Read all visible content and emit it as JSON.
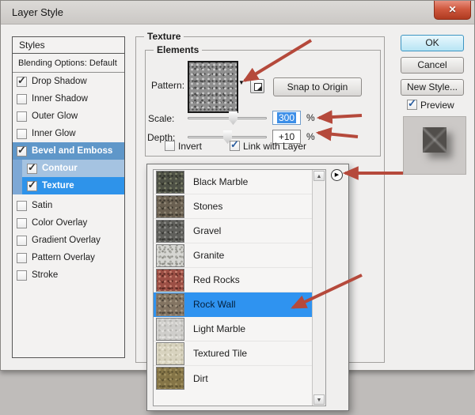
{
  "window": {
    "title": "Layer Style",
    "close_glyph": "✕"
  },
  "sidebar": {
    "header": "Styles",
    "items": [
      {
        "label": "Blending Options: Default",
        "check": ""
      },
      {
        "label": "Drop Shadow",
        "check": "✓"
      },
      {
        "label": "Inner Shadow",
        "check": ""
      },
      {
        "label": "Outer Glow",
        "check": ""
      },
      {
        "label": "Inner Glow",
        "check": ""
      },
      {
        "label": "Bevel and Emboss",
        "check": "✓",
        "selected": "medium"
      },
      {
        "label": "Contour",
        "check": "✓",
        "selected": "light",
        "sub": true
      },
      {
        "label": "Texture",
        "check": "✓",
        "selected": "bright",
        "sub": true
      },
      {
        "label": "Satin",
        "check": ""
      },
      {
        "label": "Color Overlay",
        "check": ""
      },
      {
        "label": "Gradient Overlay",
        "check": ""
      },
      {
        "label": "Pattern Overlay",
        "check": ""
      },
      {
        "label": "Stroke",
        "check": ""
      }
    ]
  },
  "texture_panel": {
    "group_label": "Texture",
    "elements_label": "Elements",
    "pattern_label": "Pattern:",
    "pattern_tex": "pattern-gray",
    "snap_button": "Snap to Origin",
    "scale": {
      "label": "Scale:",
      "value": "300",
      "unit": "%"
    },
    "depth": {
      "label": "Depth:",
      "value": "+10",
      "unit": "%"
    },
    "invert_label": "Invert",
    "invert_check": "",
    "link_label": "Link with Layer",
    "link_check": "✓"
  },
  "actions": {
    "ok": "OK",
    "cancel": "Cancel",
    "new_style": "New Style...",
    "preview_label": "Preview",
    "preview_check": "✓"
  },
  "pattern_list": {
    "items": [
      {
        "label": "Black Marble",
        "tex": "black-marble"
      },
      {
        "label": "Stones",
        "tex": "stones"
      },
      {
        "label": "Gravel",
        "tex": "gravel"
      },
      {
        "label": "Granite",
        "tex": "granite"
      },
      {
        "label": "Red Rocks",
        "tex": "red-rocks"
      },
      {
        "label": "Rock Wall",
        "tex": "rock-wall",
        "selected": true
      },
      {
        "label": "Light Marble",
        "tex": "light-marble"
      },
      {
        "label": "Textured Tile",
        "tex": "textured-tile"
      },
      {
        "label": "Dirt",
        "tex": "dirt"
      }
    ]
  },
  "icons": {
    "up": "▲",
    "down": "▼",
    "flyout": "▶",
    "pattern_dropdown": "▼"
  },
  "colors": {
    "selection_blue": "#2f93f0",
    "sidebar_selected_blue": "#5f97c9",
    "sidebar_sub_selected": "#2e93ea",
    "value_selection_blue": "#3d8fe8",
    "ok_button_cyan": "#b7e5f4",
    "annotation_arrow_red": "#b5493b",
    "close_button_red": "#c24a30"
  }
}
